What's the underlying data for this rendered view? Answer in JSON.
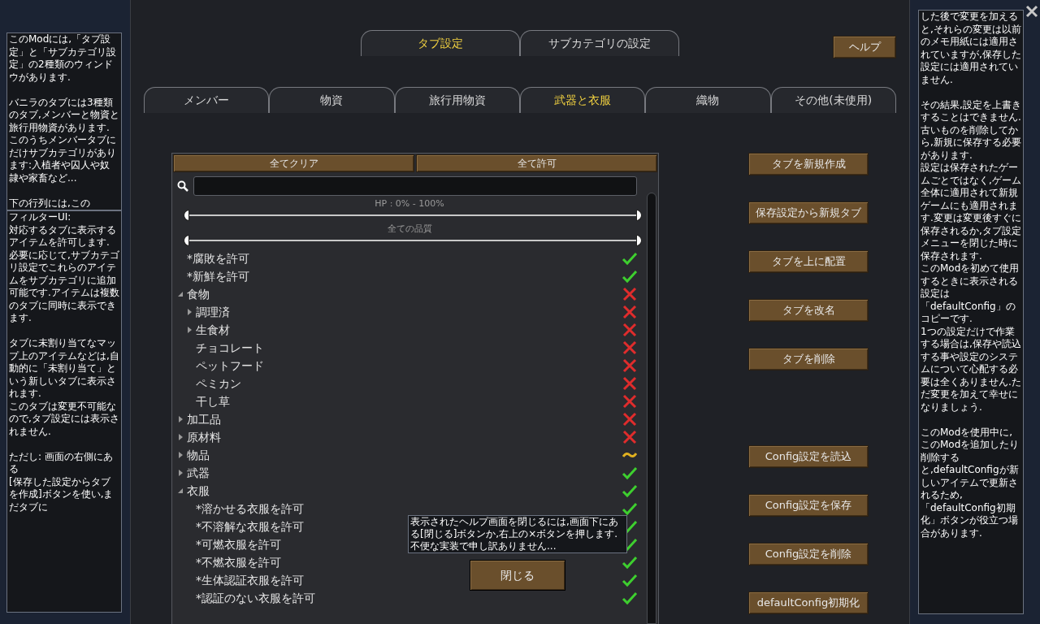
{
  "notes_left": [
    {
      "text": "このModには,「タブ設定」と「サブカテゴリ設定」の2種類のウィンドウがあります.\n\nバニラのタブには3種類のタブ,メンバーと物資と旅行用物資があります.\nこのうちメンバータブにだけサブカテゴリがあります:入植者や囚人や奴隷や家畜など...\n\n下の行列には,この"
    },
    {
      "text": "フィルターUI:\n対応するタブに表示するアイテムを許可します.\n必要に応じて,サブカテゴリ設定でこれらのアイテムをサブカテゴリに追加可能です.アイテムは複数のタブに同時に表示できます.\n\nタブに未割り当てなマップ上のアイテムなどは,自動的に「未割り当て」という新しいタブに表示されます.\nこのタブは変更不可能なので,タブ設定には表示されません.\n\nただし: 画面の右側にある\n[保存した設定からタブを作成]ボタンを使い,まだタブに"
    }
  ],
  "note_right": {
    "text": "した後で変更を加えると,それらの変更は以前のメモ用紙には適用されていますが,保存した設定には適用されていません.\n\nその結果,設定を上書きすることはできません.古いものを削除してから,新規に保存する必要があります.\n設定は保存されたゲームごとではなく,ゲーム全体に適用されて新規ゲームにも適用されます.変更は変更後すぐに保存されるか,タブ設定メニューを閉じた時に保存されます.\nこのModを初めて使用するときに表示される設定は「defaultConfig」のコピーです.\n1つの設定だけで作業する場合は,保存や読込する事や設定のシステムについて心配する必要は全くありません.ただ変更を加えて幸せになりましょう.\n\nこのModを使用中に,このModを追加したり削除すると,defaultConfigが新しいアイテムで更新されるため,「defaultConfig初期化」ボタンが役立つ場合があります."
  },
  "window_tabs": [
    {
      "label": "タブ設定",
      "selected": true
    },
    {
      "label": "サブカテゴリの設定",
      "selected": false
    }
  ],
  "help_button": "ヘルプ",
  "category_tabs": [
    {
      "label": "メンバー",
      "selected": false
    },
    {
      "label": "物資",
      "selected": false
    },
    {
      "label": "旅行用物資",
      "selected": false
    },
    {
      "label": "武器と衣服",
      "selected": true
    },
    {
      "label": "織物",
      "selected": false
    },
    {
      "label": "その他(未使用)",
      "selected": false
    }
  ],
  "filter": {
    "clear_all": "全てクリア",
    "allow_all": "全て許可",
    "sliders": [
      {
        "label": "HP : 0% - 100%",
        "thumbs": [
          {
            "level": 0
          },
          {
            "level": 1
          }
        ]
      },
      {
        "label": "全ての品質",
        "thumbs": [
          {
            "level": 0
          },
          {
            "level": 1
          }
        ]
      }
    ],
    "tree": [
      {
        "label": "*腐敗を許可",
        "kind": "allowed"
      },
      {
        "label": "*新鮮を許可",
        "kind": "allowed"
      },
      {
        "label": "食物",
        "kind": "denied",
        "expanded": true,
        "children": [
          {
            "label": "調理済",
            "kind": "denied",
            "expanded": false
          },
          {
            "label": "生食材",
            "kind": "denied",
            "expanded": false
          },
          {
            "label": "チョコレート",
            "kind": "denied"
          },
          {
            "label": "ペットフード",
            "kind": "denied"
          },
          {
            "label": "ペミカン",
            "kind": "denied"
          },
          {
            "label": "干し草",
            "kind": "denied"
          }
        ]
      },
      {
        "label": "加工品",
        "kind": "denied",
        "expanded": false
      },
      {
        "label": "原材料",
        "kind": "denied",
        "expanded": false
      },
      {
        "label": "物品",
        "kind": "partial",
        "expanded": false
      },
      {
        "label": "武器",
        "kind": "allowed",
        "expanded": false
      },
      {
        "label": "衣服",
        "kind": "allowed",
        "expanded": true,
        "children": [
          {
            "label": "*溶かせる衣服を許可",
            "kind": "allowed"
          },
          {
            "label": "*不溶解な衣服を許可",
            "kind": "allowed"
          },
          {
            "label": "*可燃衣服を許可",
            "kind": "allowed"
          },
          {
            "label": "*不燃衣服を許可",
            "kind": "allowed"
          },
          {
            "label": "*生体認証衣服を許可",
            "kind": "allowed"
          },
          {
            "label": "*認証のない衣服を許可",
            "kind": "allowed"
          }
        ]
      }
    ]
  },
  "help_popup": {
    "text": "表示されたヘルプ画面を閉じるには,画面下にある[閉じる]ボタンか,右上の×ボタンを押します.\n不便な実装で申し訳ありません...",
    "close_button": "閉じる"
  },
  "tab_buttons": [
    "タブを新規作成",
    "保存設定から新規タブ",
    "タブを上に配置",
    "タブを改名",
    "タブを削除"
  ],
  "config_buttons": [
    "Config設定を読込",
    "Config設定を保存",
    "Config設定を削除",
    "defaultConfig初期化"
  ]
}
